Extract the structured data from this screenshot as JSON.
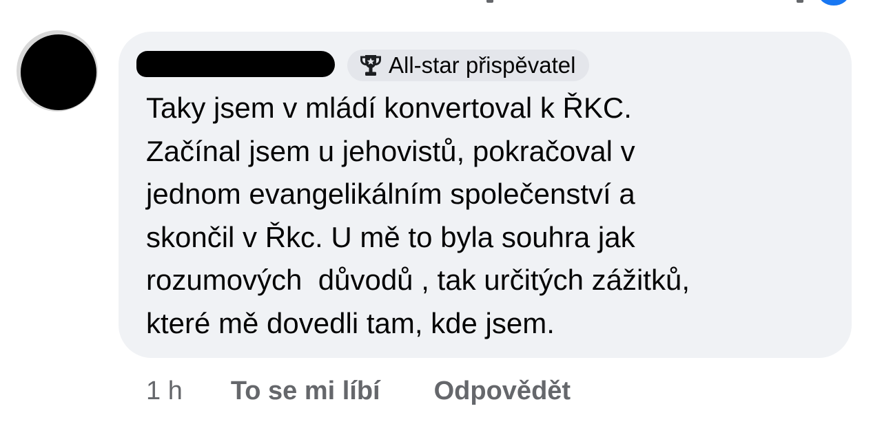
{
  "colors": {
    "bubble_background": "#f0f2f5",
    "badge_background": "#e4e6eb",
    "text_primary": "#050505",
    "text_secondary": "#65676b",
    "accent_blue": "#1877f2",
    "redaction": "#000000"
  },
  "comment": {
    "author_name_redacted": true,
    "avatar_redacted": true,
    "badge": {
      "icon": "trophy-icon",
      "label": "All-star přispěvatel"
    },
    "text_lines": [
      "Taky jsem v mládí konvertoval k ŘKC.",
      "Začínal jsem u jehovistů, pokračoval v",
      "jednom evangelikálním společenství a",
      "skončil v Řkc. U mě to byla souhra jak",
      "rozumových  důvodů , tak určitých zážitků,",
      "které mě dovedli tam, kde jsem."
    ],
    "actions": {
      "timestamp": "1 h",
      "like_label": "To se mi líbí",
      "reply_label": "Odpovědět"
    }
  }
}
